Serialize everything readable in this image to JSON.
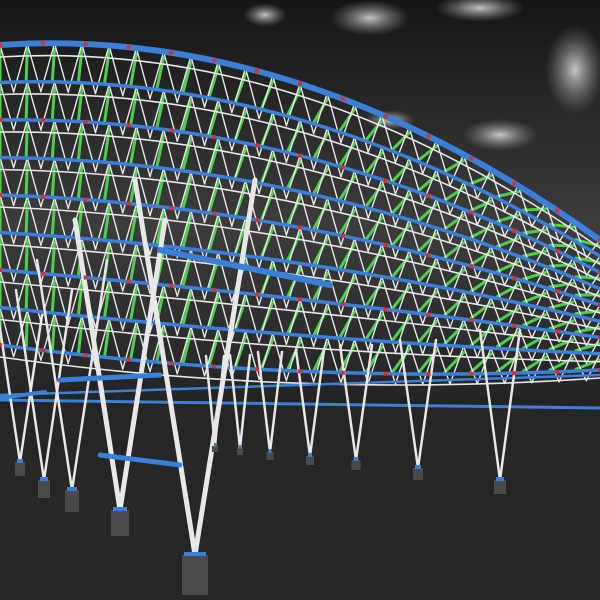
{
  "image": {
    "subject": "steel-space-frame-roof-render",
    "colors": {
      "sky_top": "#1a1a1a",
      "sky_bottom": "#5a5a5a",
      "ground": "#2a2a2a",
      "cloud": "#cfcfcf",
      "beam_blue": "#3a7fd8",
      "brace_white": "#e8e8e8",
      "purlin_green": "#4cd04c",
      "joint_red": "#d83030",
      "footing": "#4a4a4a"
    }
  }
}
